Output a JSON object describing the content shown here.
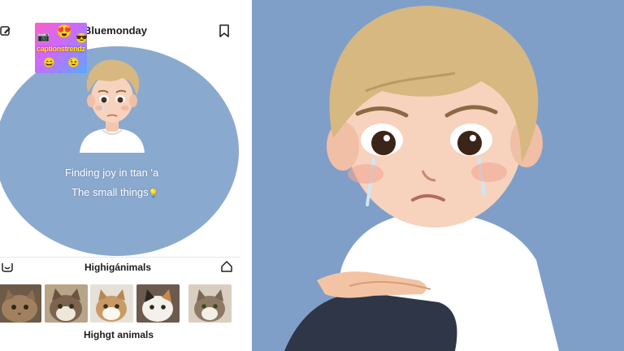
{
  "profile": {
    "name": "Bluemonday"
  },
  "logo": {
    "text": "captionstrendz"
  },
  "bio": {
    "line1": "Finding joy in ttan 'a",
    "line2": "The small things"
  },
  "highlights": {
    "title": "Highigánimals",
    "items": [
      {
        "icon": "cat-photo"
      },
      {
        "icon": "cat-photo"
      },
      {
        "icon": "cat-photo"
      },
      {
        "icon": "cat-photo"
      },
      {
        "icon": "cat-photo"
      }
    ]
  },
  "footer": {
    "title": "Highgt animals"
  },
  "icons": {
    "edit": "edit-icon",
    "bookmark": "bookmark-icon",
    "smile": "smile-icon",
    "home": "home-icon",
    "bulb": "lightbulb-icon"
  },
  "colors": {
    "circle": "#8aa9cf",
    "background_right": "#7f9fc9"
  }
}
